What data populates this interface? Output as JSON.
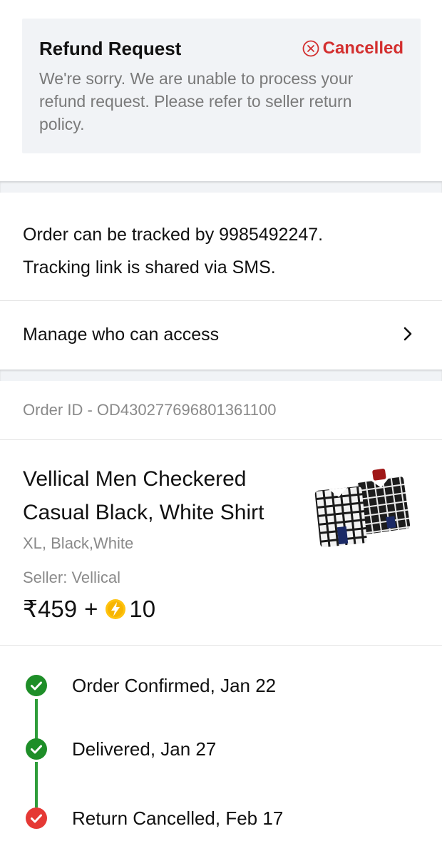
{
  "refund": {
    "title": "Refund Request",
    "status": "Cancelled",
    "message": "We're sorry. We are unable to process your refund request. Please refer to seller return policy.",
    "status_color": "#d32f2f"
  },
  "tracking": {
    "line1": "Order can be tracked by 9985492247.",
    "line2": "Tracking link is shared via SMS.",
    "manage_label": "Manage who can access"
  },
  "order": {
    "id_text": "Order ID - OD430277696801361100",
    "product_name": "Vellical Men Checkered Casual Black, White Shirt",
    "variant": "XL, Black,White",
    "seller": "Seller: Vellical",
    "price": "₹459",
    "plus": "+",
    "coins": "10"
  },
  "timeline": [
    {
      "label": "Order Confirmed, Jan 22",
      "status": "done",
      "color": "#1e8e28"
    },
    {
      "label": "Delivered, Jan 27",
      "status": "done",
      "color": "#1e8e28"
    },
    {
      "label": "Return Cancelled, Feb 17",
      "status": "cancelled",
      "color": "#e53935"
    }
  ],
  "icons": {
    "status": "cancel-circle-icon",
    "chevron": "chevron-right-icon",
    "coin": "supercoin-icon",
    "check": "check-circle-icon"
  }
}
